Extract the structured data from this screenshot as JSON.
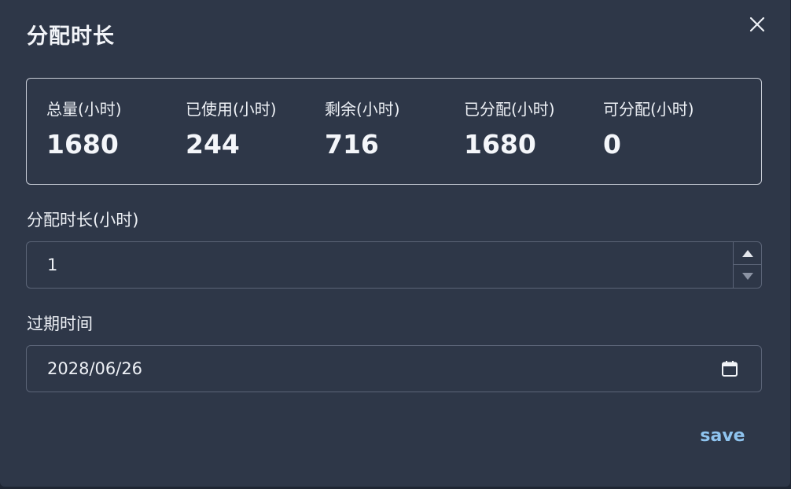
{
  "dialog": {
    "title": "分配时长",
    "close_icon": "close-icon"
  },
  "stats": [
    {
      "label": "总量(小时)",
      "value": "1680"
    },
    {
      "label": "已使用(小时)",
      "value": "244"
    },
    {
      "label": "剩余(小时)",
      "value": "716"
    },
    {
      "label": "已分配(小时)",
      "value": "1680"
    },
    {
      "label": "可分配(小时)",
      "value": "0"
    }
  ],
  "duration_field": {
    "label": "分配时长(小时)",
    "value": "1"
  },
  "expiry_field": {
    "label": "过期时间",
    "value": "2028/06/26",
    "icon": "calendar-icon"
  },
  "actions": {
    "save_label": "save"
  },
  "colors": {
    "background": "#2e3748",
    "text": "#eef1f6",
    "accent": "#8fc4ef",
    "border": "#5b6477"
  }
}
